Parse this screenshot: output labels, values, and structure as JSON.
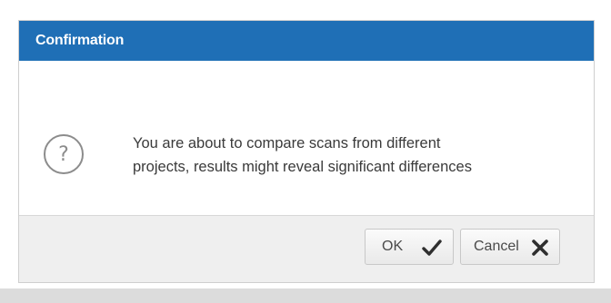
{
  "dialog": {
    "title": "Confirmation",
    "message_line1": "You are about to compare scans from different",
    "message_line2": "projects, results might reveal significant differences",
    "icon": "question-circle-icon"
  },
  "buttons": {
    "ok_label": "OK",
    "ok_icon": "checkmark-icon",
    "cancel_label": "Cancel",
    "cancel_icon": "x-icon"
  },
  "colors": {
    "titlebar": "#1f6fb6",
    "title_text": "#ffffff",
    "footer": "#efefef",
    "icon_gray": "#8c8c8c"
  }
}
